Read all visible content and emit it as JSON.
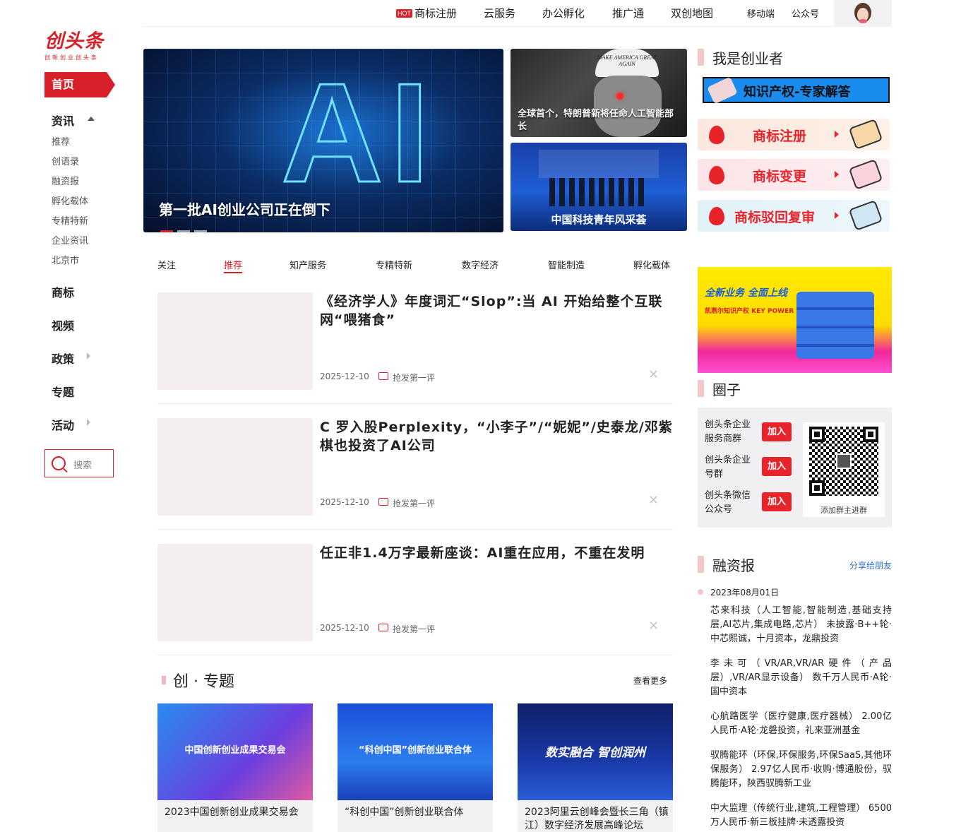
{
  "brand": {
    "logo": "创头条",
    "slogan": "创新创业创头条"
  },
  "topnav": {
    "hot_badge": "HOT",
    "items": [
      "商标注册",
      "云服务",
      "办公孵化",
      "推广通",
      "双创地图"
    ],
    "mobile": "移动端",
    "official": "公众号"
  },
  "sidebar": {
    "home": "首页",
    "news": "资讯",
    "news_sub": [
      "推荐",
      "创语录",
      "融资报",
      "孵化载体",
      "专精特新",
      "企业资讯",
      "北京市"
    ],
    "trademark": "商标",
    "video": "视频",
    "policy": "政策",
    "topic": "专题",
    "event": "活动",
    "search_placeholder": "搜索"
  },
  "hero": {
    "main_title": "第一批AI创业公司正在倒下",
    "main_letters": "AI",
    "hat_text": "MAKE AMERICA GREAT AGAIN",
    "side1_title": "全球首个，特朗普新将任命人工智能部长",
    "side2_title": "中国科技青年风采荟"
  },
  "tabs": [
    "关注",
    "推荐",
    "知产服务",
    "专精特新",
    "数字经济",
    "智能制造",
    "孵化载体"
  ],
  "active_tab": "推荐",
  "articles": [
    {
      "title": "《经济学人》年度词汇“Slop”:当 AI 开始给整个互联网“喂猪食”",
      "date": "2025-12-10",
      "comment": "抢发第一评"
    },
    {
      "title": "C 罗入股Perplexity，“小李子”/“妮妮”/史泰龙/邓紫棋也投资了AI公司",
      "date": "2025-12-10",
      "comment": "抢发第一评"
    },
    {
      "title": "任正非1.4万字最新座谈：AI重在应用，不重在发明",
      "date": "2025-12-10",
      "comment": "抢发第一评"
    }
  ],
  "close_glyph": "✕",
  "topics": {
    "title": "创 · 专题",
    "more": "查看更多",
    "items": [
      {
        "caption": "2023中国创新创业成果交易会",
        "banner": "中国创新创业成果交易会"
      },
      {
        "caption": "“科创中国”创新创业联合体",
        "banner": "“科创中国”创新创业联合体"
      },
      {
        "caption": "2023阿里云创峰会暨长三角（镇江）数字经济发展高峰论坛",
        "banner": "数实融合 智创润州"
      }
    ]
  },
  "right": {
    "entrepreneur_title": "我是创业者",
    "ip_banner": "知识产权-专家解答",
    "services": [
      "商标注册",
      "商标变更",
      "商标驳回复审"
    ],
    "promo_line1": "全新业务 全面上线",
    "promo_line2": "凯燕尔知识产权 KEY POWER",
    "circle_title": "圈子",
    "groups": [
      "创头条企业服务商群",
      "创头条企业号群",
      "创头条微信公众号"
    ],
    "join_label": "加入",
    "qr_caption": "添加群主进群",
    "funding_title": "融资报",
    "share": "分享给朋友",
    "funding_date": "2023年08月01日",
    "funding_items": [
      "芯来科技（人工智能,智能制造,基础支持层,AI芯片,集成电路,芯片） 未披露·B++轮·中芯熙诚，十月资本，龙鼎投资",
      "李未可（VR/AR,VR/AR硬件（产品层）,VR/AR显示设备） 数千万人民币·A轮·国中资本",
      "心航路医学（医疗健康,医疗器械） 2.00亿人民币·A轮·龙磐投资，礼来亚洲基金",
      "驭腾能环（环保,环保服务,环保SaaS,其他环保服务） 2.97亿人民币·收购·博通股份，驭腾能环，陕西驭腾新工业",
      "中大监理（传统行业,建筑,工程管理） 6500万人民币·新三板挂牌·未透露投资"
    ]
  },
  "colors": {
    "brand_red": "#d7202a",
    "link_blue": "#2a6ec8",
    "accent_pink": "#f3c6c9"
  }
}
